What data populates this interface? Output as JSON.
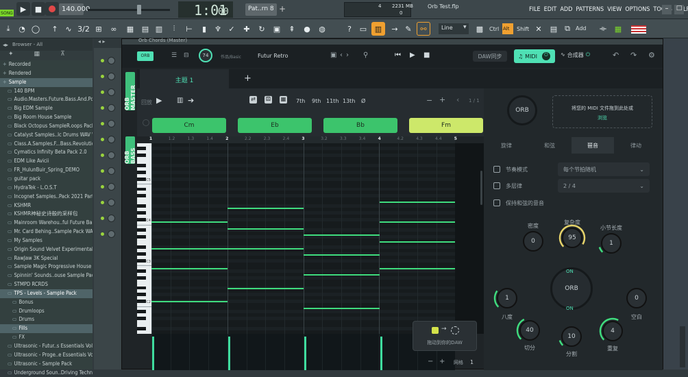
{
  "app": {
    "song_mode": "SONG",
    "tempo": "140.000",
    "time": "1:01",
    "time_sub": "00",
    "pattern": "Pat..rn 8",
    "cpu_left": "4",
    "memory": "2231 MB",
    "memory_sub": "0",
    "project_name": "Orb Test.flp",
    "menu": [
      "FILE",
      "EDIT",
      "ADD",
      "PATTERNS",
      "VIEW",
      "OPTIONS",
      "TOOLS",
      "HELP"
    ],
    "snap": "Line",
    "mod_keys": [
      "Ctrl",
      "Alt",
      "Shift"
    ],
    "add_label": "Add"
  },
  "browser": {
    "title": "Browser - All",
    "items": [
      {
        "label": "Recorded",
        "indent": 0
      },
      {
        "label": "Rendered",
        "indent": 0
      },
      {
        "label": "Sample",
        "indent": 0,
        "selected": true
      },
      {
        "label": "140 BPM",
        "indent": 1
      },
      {
        "label": "Audio.Masters.Future.Bass.And.Pop",
        "indent": 1
      },
      {
        "label": "Big EDM Sample",
        "indent": 1
      },
      {
        "label": "Big Room House Sample",
        "indent": 1
      },
      {
        "label": "Black Octopus SampleR.oops Pack",
        "indent": 1
      },
      {
        "label": "Catalyst Samples..lc Drums WAV WAV",
        "indent": 1
      },
      {
        "label": "Class.A.Samples.F...Bass.Revolution",
        "indent": 1
      },
      {
        "label": "Cymatics Infinity Beta Pack 2.0",
        "indent": 1
      },
      {
        "label": "EDM Like Avicii",
        "indent": 1
      },
      {
        "label": "FR_HulunBuir_Spring_DEMO",
        "indent": 1
      },
      {
        "label": "guitar pack",
        "indent": 1
      },
      {
        "label": "HydraTek - L.O.S.T",
        "indent": 1
      },
      {
        "label": "Incognet Samples..Pack 2021 Part 3",
        "indent": 1
      },
      {
        "label": "KSHMR",
        "indent": 1
      },
      {
        "label": "KSHMR神秘史诗般的采样包",
        "indent": 1
      },
      {
        "label": "Mainroom Warehou..ful Future Bass",
        "indent": 1
      },
      {
        "label": "Mr. Card Behing..Sample Pack WAV",
        "indent": 1
      },
      {
        "label": "My Samples",
        "indent": 1
      },
      {
        "label": "Origin Sound Velvet Experimental",
        "indent": 1
      },
      {
        "label": "RawJaw 3K Special",
        "indent": 1
      },
      {
        "label": "Sample Magic Progressive House 2",
        "indent": 1
      },
      {
        "label": "Spinnin' Sounds..ouse Sample Pack",
        "indent": 1
      },
      {
        "label": "STMPD RCRDS",
        "indent": 1
      },
      {
        "label": "TPS - Levels - Sample Pack",
        "indent": 1,
        "selected": true
      },
      {
        "label": "Bonus",
        "indent": 2
      },
      {
        "label": "Drumloops",
        "indent": 2
      },
      {
        "label": "Drums",
        "indent": 2
      },
      {
        "label": "Fills",
        "indent": 2,
        "selected": true
      },
      {
        "label": "FX",
        "indent": 2
      },
      {
        "label": "Ultrasonic - Futur..s Essentials Vol.2",
        "indent": 1
      },
      {
        "label": "Ultrasonic - Proge..e Essentials Vol.1",
        "indent": 1
      },
      {
        "label": "Ultrasonic - Sample Pack",
        "indent": 1
      },
      {
        "label": "Underground Soun..Driving Techno",
        "indent": 1
      }
    ]
  },
  "plugin": {
    "window_title": "Orb Chords (Master)",
    "top": {
      "logo": "ORB",
      "tempo_knob": "74",
      "preset_label": "作品/Basic",
      "preset_value": "Futur Retro",
      "daw_sync": "DAW同步",
      "midi_label": "MIDI",
      "synth_label": "合成器"
    },
    "side_tabs": [
      "ORB MASTER",
      "ORB BASS"
    ],
    "tabs": [
      "主题 1",
      "+"
    ],
    "controls": {
      "play_label": "回放",
      "chord_types": [
        "7th",
        "9th",
        "11th",
        "13th",
        "Ø"
      ],
      "page": "1 / 1"
    },
    "chords": [
      "Cm",
      "Eb",
      "Bb",
      "Fm"
    ],
    "chord_colors": [
      "#3cc46c",
      "#3cc46c",
      "#3cc46c",
      "#cde86a"
    ],
    "ruler": [
      "1",
      "1.2",
      "1.3",
      "1.4",
      "2",
      "2.2",
      "2.3",
      "2.4",
      "3",
      "3.2",
      "3.3",
      "3.4",
      "4",
      "4.2",
      "4.3",
      "4.4",
      "5"
    ],
    "piano_labels": [
      "C5",
      "C4",
      "C3",
      "C2",
      "C1"
    ],
    "notes": [
      {
        "bar": 0,
        "pitch": 4
      },
      {
        "bar": 0,
        "pitch": 8
      },
      {
        "bar": 0,
        "pitch": 11
      },
      {
        "bar": 0,
        "pitch": 16
      },
      {
        "bar": 1,
        "pitch": 2
      },
      {
        "bar": 1,
        "pitch": 5
      },
      {
        "bar": 1,
        "pitch": 8
      },
      {
        "bar": 1,
        "pitch": 14
      },
      {
        "bar": 2,
        "pitch": 6
      },
      {
        "bar": 2,
        "pitch": 9
      },
      {
        "bar": 2,
        "pitch": 12
      },
      {
        "bar": 2,
        "pitch": 17
      },
      {
        "bar": 3,
        "pitch": 1
      },
      {
        "bar": 3,
        "pitch": 4
      },
      {
        "bar": 3,
        "pitch": 7
      },
      {
        "bar": 3,
        "pitch": 11
      }
    ],
    "drag": {
      "label": "拖动到你的DAW"
    },
    "grid_label": "网格",
    "grid_value": "1",
    "orb_knob": "ORB",
    "midi_drop": {
      "line1": "将您的 MIDI 文件拖到此处或",
      "line2": "浏览"
    },
    "right_tabs": [
      "旋律",
      "和弦",
      "琶音",
      "律动"
    ],
    "right_active": 2,
    "options": [
      {
        "label": "节奏模式",
        "dropdown": "每个节拍随机"
      },
      {
        "label": "多层律",
        "dropdown": "2 / 4"
      },
      {
        "label": "保持和弦的意音",
        "dropdown": ""
      }
    ],
    "knobs_row1": [
      {
        "label": "密度",
        "value": "0",
        "level": 0
      },
      {
        "label": "复杂度",
        "value": "95",
        "level": 0.95
      },
      {
        "label": "小节长度",
        "value": "1",
        "level": 0.1
      }
    ],
    "knobs_row2": [
      {
        "label": "八度",
        "value": "1",
        "level": 0.3
      },
      {
        "label": "ORB",
        "value": "ORB",
        "on_top": "ON",
        "on_bottom": "ON"
      },
      {
        "label": "空白",
        "value": "0",
        "level": 0
      }
    ],
    "knobs_row3": [
      {
        "label": "切分",
        "value": "40",
        "level": 0.4
      },
      {
        "label": "分割",
        "value": "10",
        "level": 0.1
      },
      {
        "label": "重复",
        "value": "4",
        "level": 0.6
      }
    ]
  }
}
